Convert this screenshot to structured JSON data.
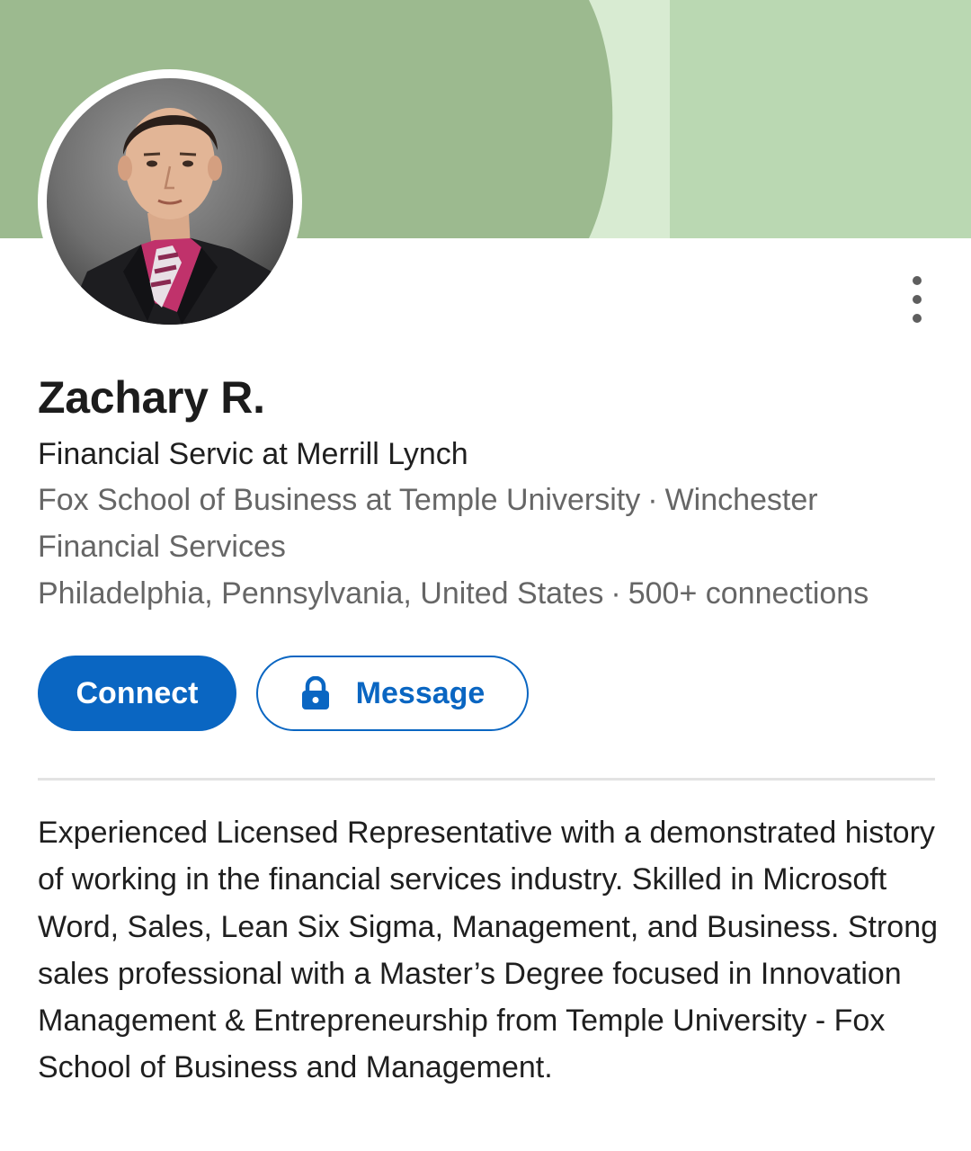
{
  "profile": {
    "name": "Zachary R.",
    "headline": "Financial Servic at Merrill Lynch",
    "education_line": "Fox School of Business at Temple University",
    "company_line": "Winchester Financial Services",
    "location": "Philadelphia, Pennsylvania, United States",
    "connections": "500+ connections",
    "separator": "·"
  },
  "actions": {
    "connect_label": "Connect",
    "message_label": "Message"
  },
  "about": {
    "text": "Experienced Licensed Representative with a demonstrated history of working in the financial services industry. Skilled in Microsoft Word, Sales, Lean Six Sigma, Management, and Business. Strong sales professional with a Master’s Degree focused in Innovation Management & Entrepreneurship from Temple University - Fox School of Business and Management."
  },
  "icons": {
    "menu": "more-vertical-icon",
    "lock": "lock-icon"
  },
  "colors": {
    "banner_dark": "#9cba8f",
    "banner_light": "#bad8b2",
    "banner_highlight": "#d8ebd2",
    "primary": "#0a66c2",
    "muted_text": "#666666"
  }
}
